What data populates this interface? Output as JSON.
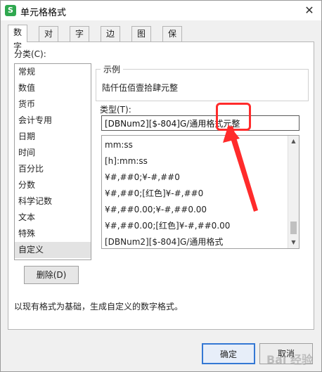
{
  "window": {
    "title": "单元格格式",
    "close_glyph": "✕",
    "app_icon": "S"
  },
  "tabs": [
    {
      "label": "数字",
      "active": true
    },
    {
      "label": "对齐",
      "active": false
    },
    {
      "label": "字体",
      "active": false
    },
    {
      "label": "边框",
      "active": false
    },
    {
      "label": "图案",
      "active": false
    },
    {
      "label": "保护",
      "active": false
    }
  ],
  "category": {
    "label": "分类(C):",
    "items": [
      "常规",
      "数值",
      "货币",
      "会计专用",
      "日期",
      "时间",
      "百分比",
      "分数",
      "科学记数",
      "文本",
      "特殊",
      "自定义"
    ],
    "selected": "自定义"
  },
  "sample": {
    "label": "示例",
    "value": "陆仟伍佰壹拾肆元整"
  },
  "type": {
    "label": "类型(T):",
    "value": "[DBNum2][$-804]G/通用格式元整"
  },
  "format_list": {
    "items": [
      "mm:ss",
      "[h]:mm:ss",
      "¥#,##0;¥-#,##0",
      "¥#,##0;[红色]¥-#,##0",
      "¥#,##0.00;¥-#,##0.00",
      "¥#,##0.00;[红色]¥-#,##0.00",
      "[DBNum2][$-804]G/通用格式"
    ],
    "scroll_up": "▲",
    "scroll_down": "▼"
  },
  "buttons": {
    "delete": "删除(D)",
    "ok": "确定",
    "cancel": "取消"
  },
  "description": "以现有格式为基础，生成自定义的数字格式。",
  "watermark": "Bai 经验",
  "colors": {
    "annotation": "#ff2b2b",
    "ok_border": "#3478d4",
    "app_icon": "#2fa84f"
  }
}
